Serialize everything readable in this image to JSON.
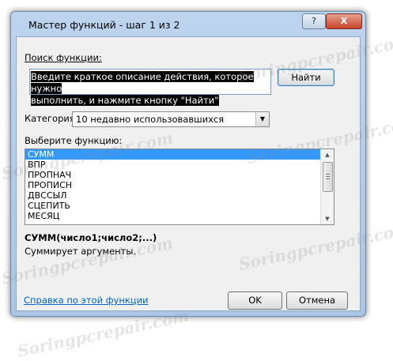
{
  "window": {
    "title": "Мастер функций - шаг 1 из 2",
    "help_button": "?",
    "close_button": "X"
  },
  "search": {
    "label": "Поиск функции:",
    "text_line1": "Введите краткое описание действия, которое нужно",
    "text_line2": "выполнить, и нажмите кнопку \"Найти\"",
    "find_button": "Найти"
  },
  "category": {
    "label": "Категория:",
    "selected": "10 недавно использовавшихся"
  },
  "functions": {
    "label": "Выберите функцию:",
    "items": [
      "СУММ",
      "ВПР",
      "ПРОПНАЧ",
      "ПРОПИСН",
      "ДВССЫЛ",
      "СЦЕПИТЬ",
      "МЕСЯЦ"
    ],
    "selected_index": 0,
    "signature": "СУММ(число1;число2;...)",
    "description": "Суммирует аргументы."
  },
  "footer": {
    "help_link": "Справка по этой функции",
    "ok_button": "OK",
    "cancel_button": "Отмена"
  },
  "watermark": "Soringpcrepair.com",
  "colors": {
    "selection": "#3399ff",
    "link": "#0066cc",
    "close_button": "#c7432a"
  }
}
